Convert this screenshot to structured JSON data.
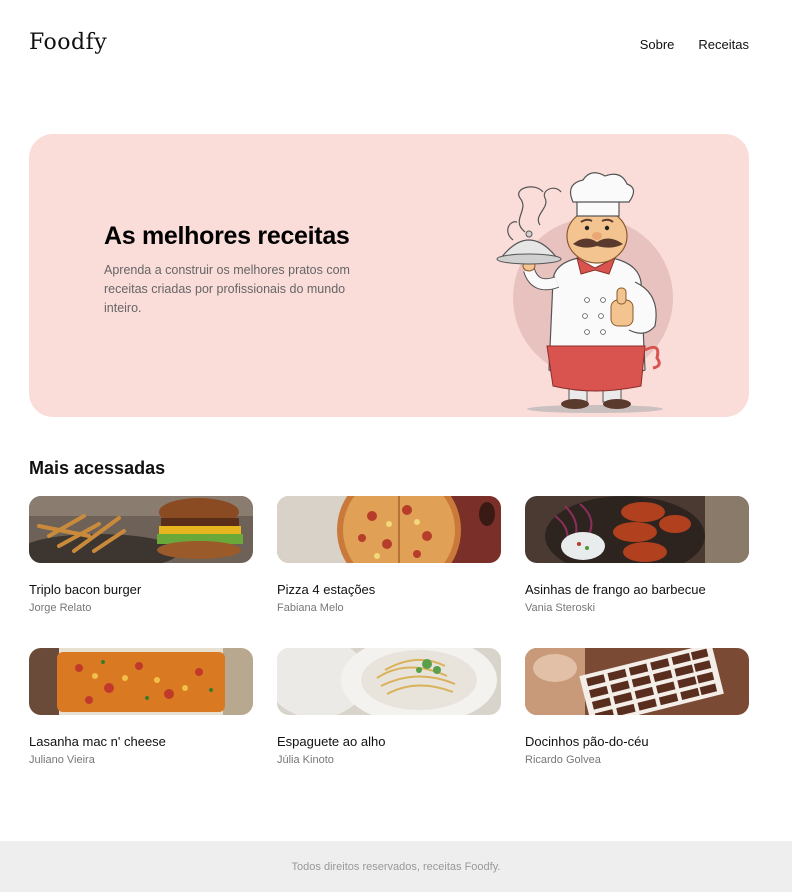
{
  "header": {
    "logo": "Foodfy",
    "nav": [
      {
        "label": "Sobre"
      },
      {
        "label": "Receitas"
      }
    ]
  },
  "hero": {
    "title": "As melhores receitas",
    "description": "Aprenda a construir os melhores pratos com receitas criadas por profissionais do mundo inteiro.",
    "illustration": "chef-illustration"
  },
  "section": {
    "title": "Mais acessadas"
  },
  "recipes": [
    {
      "title": "Triplo bacon burger",
      "author": "Jorge Relato",
      "image": "burger-fries-photo"
    },
    {
      "title": "Pizza 4 estações",
      "author": "Fabiana Melo",
      "image": "pizza-photo"
    },
    {
      "title": "Asinhas de frango ao barbecue",
      "author": "Vania Steroski",
      "image": "chicken-wings-photo"
    },
    {
      "title": "Lasanha mac n' cheese",
      "author": "Juliano Vieira",
      "image": "lasagna-photo"
    },
    {
      "title": "Espaguete ao alho",
      "author": "Júlia Kinoto",
      "image": "spaghetti-photo"
    },
    {
      "title": "Docinhos pão-do-céu",
      "author": "Ricardo Golvea",
      "image": "chocolates-photo"
    }
  ],
  "footer": {
    "text": "Todos direitos reservados, receitas Foodfy."
  },
  "colors": {
    "hero_bg": "#fadcd9",
    "footer_bg": "#eeeeee",
    "text": "#111111",
    "muted": "#777777"
  }
}
